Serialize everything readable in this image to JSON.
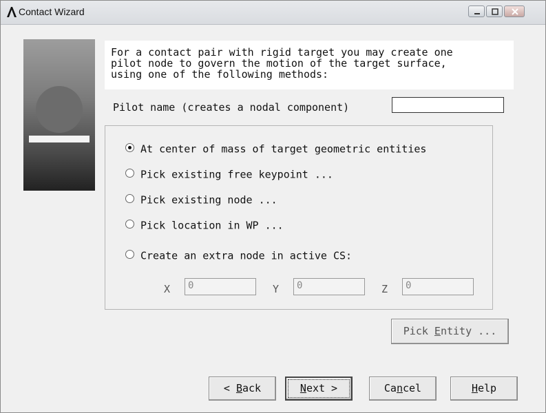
{
  "window": {
    "title": "Contact Wizard",
    "controls": [
      "minimize-icon",
      "maximize-icon",
      "close-icon"
    ]
  },
  "intro_text": "For a contact pair with rigid target you may create one\npilot node to govern the motion of the target surface,\nusing one of the following methods:",
  "pilot": {
    "label": "Pilot name (creates a nodal component)",
    "value": ""
  },
  "methods": {
    "selected_index": 0,
    "options": [
      "At center of mass of target geometric entities",
      "Pick existing free keypoint ...",
      "Pick existing node ...",
      "Pick location in WP ...",
      "Create an extra node in active CS:"
    ]
  },
  "coords": {
    "x_label": "X",
    "x_value": "0",
    "y_label": "Y",
    "y_value": "0",
    "z_label": "Z",
    "z_value": "0"
  },
  "buttons": {
    "pick_entity": {
      "pre": "Pick ",
      "ul": "E",
      "post": "ntity ..."
    },
    "back": {
      "pre": "< ",
      "ul": "B",
      "post": "ack"
    },
    "next": {
      "pre": "",
      "ul": "N",
      "post": "ext >"
    },
    "cancel": {
      "pre": "Ca",
      "ul": "n",
      "post": "cel"
    },
    "help": {
      "pre": "",
      "ul": "H",
      "post": "elp"
    }
  }
}
